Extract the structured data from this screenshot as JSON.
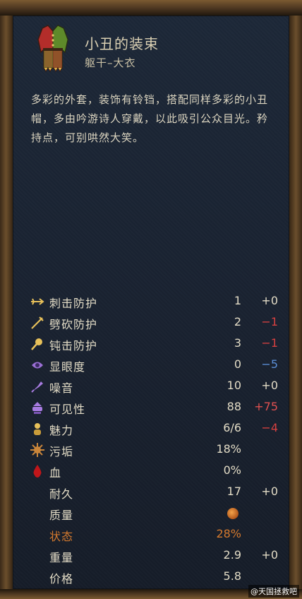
{
  "item": {
    "name": "小丑的装束",
    "type": "躯干–大衣",
    "description": "多彩的外套，装饰有铃铛，搭配同样多彩的小丑帽，多由吟游诗人穿戴，以此吸引公众目光。矜持点，可别哄然大笑。",
    "icon": "jester-coat-icon"
  },
  "stats": [
    {
      "label": "刺击防护",
      "icon": "stab-icon",
      "value": "1",
      "delta": "+0",
      "delta_color": "#e3dcc6"
    },
    {
      "label": "劈砍防护",
      "icon": "slash-icon",
      "value": "2",
      "delta": "−1",
      "delta_color": "#d64040"
    },
    {
      "label": "钝击防护",
      "icon": "blunt-icon",
      "value": "3",
      "delta": "−1",
      "delta_color": "#d64040"
    },
    {
      "label": "显眼度",
      "icon": "conspicuousness-icon",
      "value": "0",
      "delta": "−5",
      "delta_color": "#5b8ed6"
    },
    {
      "label": "噪音",
      "icon": "noise-icon",
      "value": "10",
      "delta": "+0",
      "delta_color": "#e3dcc6"
    },
    {
      "label": "可见性",
      "icon": "visibility-icon",
      "value": "88",
      "delta": "+75",
      "delta_color": "#e05050"
    },
    {
      "label": "魅力",
      "icon": "charisma-icon",
      "value": "6/6",
      "delta": "−4",
      "delta_color": "#d64040"
    },
    {
      "label": "污垢",
      "icon": "dirt-icon",
      "value": "18%",
      "delta": "",
      "delta_color": "#e3dcc6"
    },
    {
      "label": "血",
      "icon": "blood-icon",
      "value": "0%",
      "delta": "",
      "delta_color": "#e3dcc6"
    },
    {
      "label": "耐久",
      "icon": "",
      "value": "17",
      "delta": "+0",
      "delta_color": "#e3dcc6"
    },
    {
      "label": "质量",
      "icon": "",
      "value": "",
      "delta": "",
      "delta_color": "#e3dcc6"
    },
    {
      "label": "状态",
      "icon": "",
      "value": "28%",
      "delta": "",
      "delta_color": "#e3dcc6"
    },
    {
      "label": "重量",
      "icon": "",
      "value": "2.9",
      "delta": "+0",
      "delta_color": "#e3dcc6"
    },
    {
      "label": "价格",
      "icon": "",
      "value": "5.8",
      "delta": "",
      "delta_color": "#e3dcc6"
    }
  ],
  "quality_icon": "quality-coin-icon",
  "condition_color": "#d57a2e",
  "watermark": "@天国拯救吧"
}
